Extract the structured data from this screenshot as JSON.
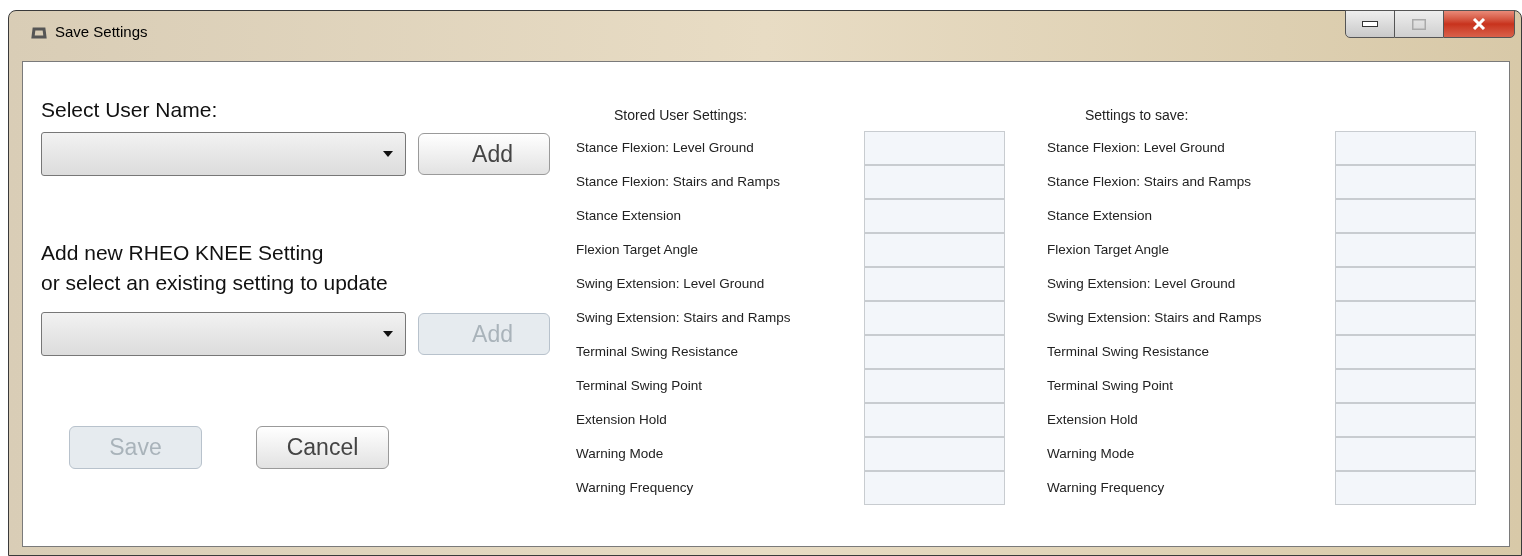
{
  "window": {
    "title": "Save Settings"
  },
  "user_section": {
    "label": "Select User Name:",
    "add_button": {
      "label": "Add",
      "disabled": false
    }
  },
  "setting_section": {
    "lines": [
      "Add new RHEO KNEE Setting",
      "or select an existing setting to update"
    ],
    "add_button": {
      "label": "Add",
      "disabled": true
    }
  },
  "buttons": [
    {
      "label": "Save",
      "disabled": true
    },
    {
      "label": "Cancel",
      "disabled": false
    }
  ],
  "columns": [
    {
      "heading": "Stored User Settings:",
      "rows": [
        "Stance Flexion: Level Ground",
        "Stance Flexion: Stairs and Ramps",
        "Stance Extension",
        "Flexion Target Angle",
        "Swing Extension: Level Ground",
        "Swing Extension: Stairs and Ramps",
        "Terminal Swing Resistance",
        "Terminal Swing Point",
        "Extension Hold",
        "Warning Mode",
        "Warning Frequency"
      ]
    },
    {
      "heading": "Settings to save:",
      "rows": [
        "Stance Flexion: Level Ground",
        "Stance Flexion: Stairs and Ramps",
        "Stance Extension",
        "Flexion Target Angle",
        "Swing Extension: Level Ground",
        "Swing Extension: Stairs and Ramps",
        "Terminal Swing Resistance",
        "Terminal Swing Point",
        "Extension Hold",
        "Warning Mode",
        "Warning Frequency"
      ]
    }
  ]
}
